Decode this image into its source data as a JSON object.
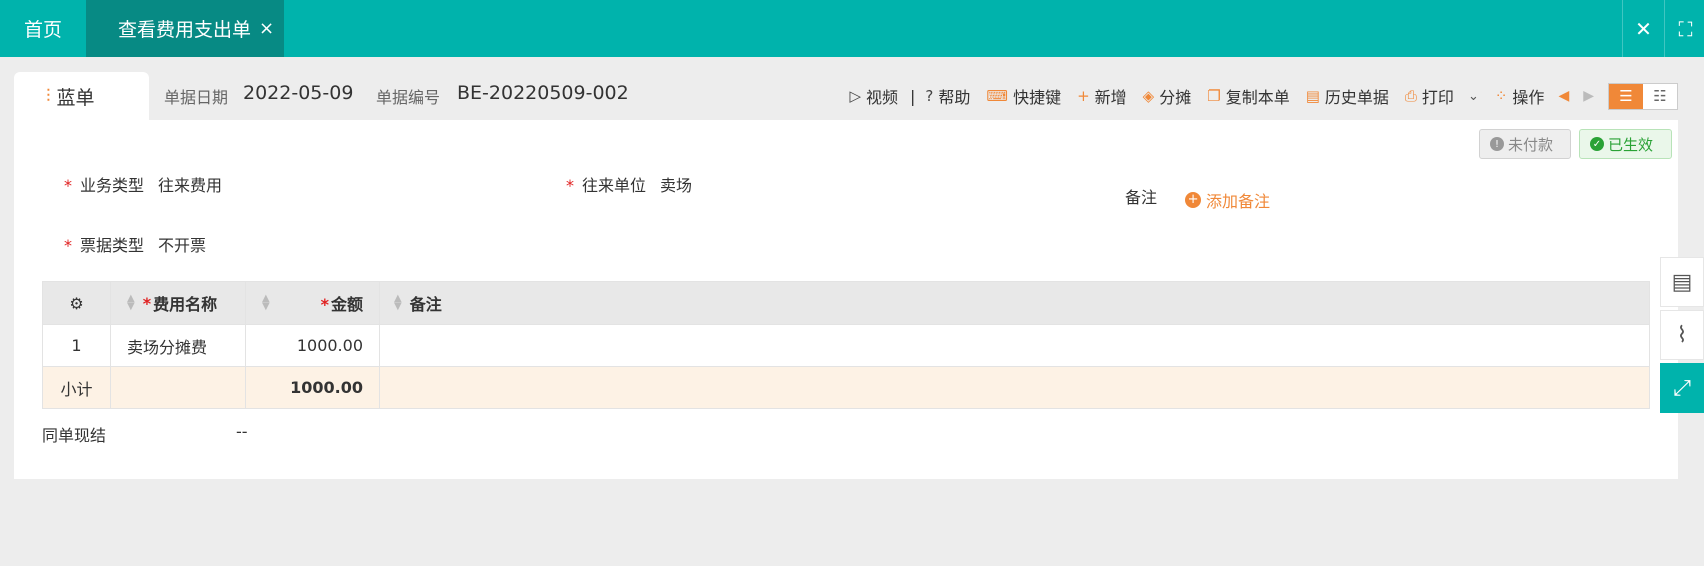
{
  "topbar": {
    "home_tab": "首页",
    "active_tab": "查看费用支出单",
    "close_symbol": "×"
  },
  "header": {
    "doc_tab_label": "蓝单",
    "date_label": "单据日期",
    "date_value": "2022-05-09",
    "number_label": "单据编号",
    "number_value": "BE-20220509-002"
  },
  "toolbar": {
    "video": "视频",
    "help": "帮助",
    "shortcut": "快捷键",
    "add": "新增",
    "allocate": "分摊",
    "copy": "复制本单",
    "history": "历史单据",
    "print": "打印",
    "operation": "操作"
  },
  "status": {
    "unpaid": "未付款",
    "effective": "已生效"
  },
  "form": {
    "business_type_label": "业务类型",
    "business_type_value": "往来费用",
    "partner_label": "往来单位",
    "partner_value": "卖场",
    "note_label": "备注",
    "add_note": "添加备注",
    "invoice_type_label": "票据类型",
    "invoice_type_value": "不开票",
    "required_mark": "*"
  },
  "table": {
    "columns": [
      "费用名称",
      "金额",
      "备注"
    ],
    "rows": [
      {
        "index": "1",
        "name": "卖场分摊费",
        "amount": "1000.00",
        "note": ""
      }
    ],
    "subtotal_label": "小计",
    "subtotal_amount": "1000.00"
  },
  "footer": {
    "settle_label": "同单现结",
    "settle_value": "--"
  },
  "colors": {
    "brand": "#00b3ac",
    "accent": "#f08838",
    "success": "#2aa236",
    "required": "#e02020"
  }
}
